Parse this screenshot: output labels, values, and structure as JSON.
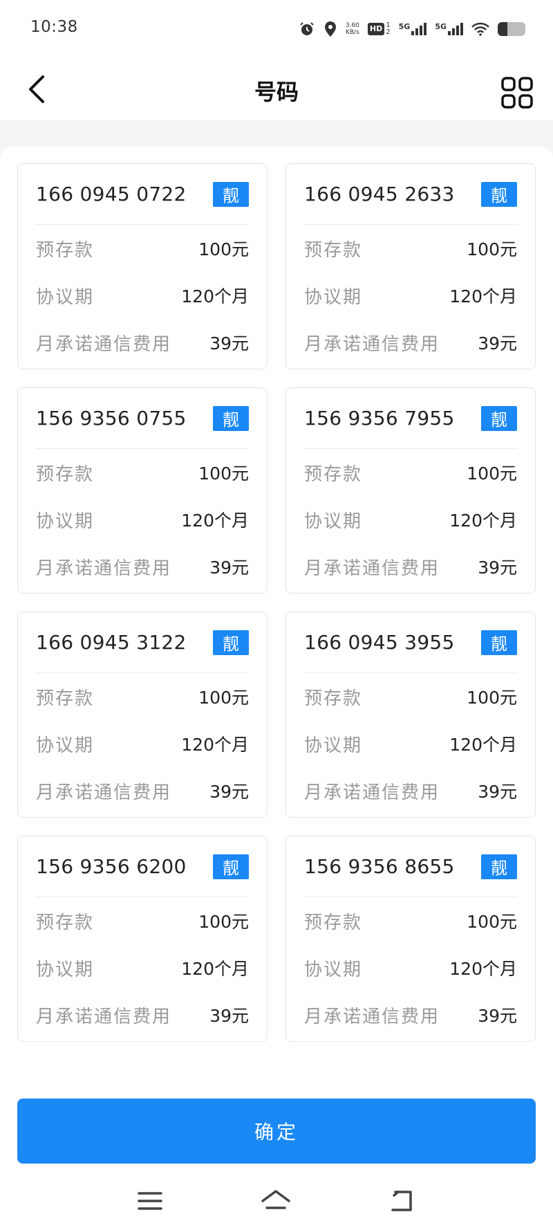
{
  "status": {
    "time": "10:38",
    "speed_value": "3.60",
    "speed_unit": "KB/s",
    "hd_label": "HD",
    "hd_sub_top": "1",
    "hd_sub_bottom": "2",
    "net1": "5G",
    "net2": "5G",
    "battery_level": 0.35
  },
  "header": {
    "title": "号码",
    "back_icon": "chevron-left-icon",
    "grid_icon": "grid-icon"
  },
  "cards": [
    {
      "number": "166 0945 0722",
      "tag": "靓",
      "rows": [
        {
          "label": "预存款",
          "value": "100元"
        },
        {
          "label": "协议期",
          "value": "120个月"
        },
        {
          "label": "月承诺通信费用",
          "value": "39元"
        }
      ]
    },
    {
      "number": "166 0945 2633",
      "tag": "靓",
      "rows": [
        {
          "label": "预存款",
          "value": "100元"
        },
        {
          "label": "协议期",
          "value": "120个月"
        },
        {
          "label": "月承诺通信费用",
          "value": "39元"
        }
      ]
    },
    {
      "number": "156 9356 0755",
      "tag": "靓",
      "rows": [
        {
          "label": "预存款",
          "value": "100元"
        },
        {
          "label": "协议期",
          "value": "120个月"
        },
        {
          "label": "月承诺通信费用",
          "value": "39元"
        }
      ]
    },
    {
      "number": "156 9356 7955",
      "tag": "靓",
      "rows": [
        {
          "label": "预存款",
          "value": "100元"
        },
        {
          "label": "协议期",
          "value": "120个月"
        },
        {
          "label": "月承诺通信费用",
          "value": "39元"
        }
      ]
    },
    {
      "number": "166 0945 3122",
      "tag": "靓",
      "rows": [
        {
          "label": "预存款",
          "value": "100元"
        },
        {
          "label": "协议期",
          "value": "120个月"
        },
        {
          "label": "月承诺通信费用",
          "value": "39元"
        }
      ]
    },
    {
      "number": "166 0945 3955",
      "tag": "靓",
      "rows": [
        {
          "label": "预存款",
          "value": "100元"
        },
        {
          "label": "协议期",
          "value": "120个月"
        },
        {
          "label": "月承诺通信费用",
          "value": "39元"
        }
      ]
    },
    {
      "number": "156 9356 6200",
      "tag": "靓",
      "rows": [
        {
          "label": "预存款",
          "value": "100元"
        },
        {
          "label": "协议期",
          "value": "120个月"
        },
        {
          "label": "月承诺通信费用",
          "value": "39元"
        }
      ]
    },
    {
      "number": "156 9356 8655",
      "tag": "靓",
      "rows": [
        {
          "label": "预存款",
          "value": "100元"
        },
        {
          "label": "协议期",
          "value": "120个月"
        },
        {
          "label": "月承诺通信费用",
          "value": "39元"
        }
      ]
    }
  ],
  "footer": {
    "confirm_label": "确定"
  },
  "nav": {
    "menu_icon": "menu-icon",
    "home_icon": "home-icon",
    "back_icon": "back-icon"
  },
  "colors": {
    "accent": "#1a88f5",
    "label_gray": "#9a9a9a",
    "text_dark": "#222222"
  }
}
